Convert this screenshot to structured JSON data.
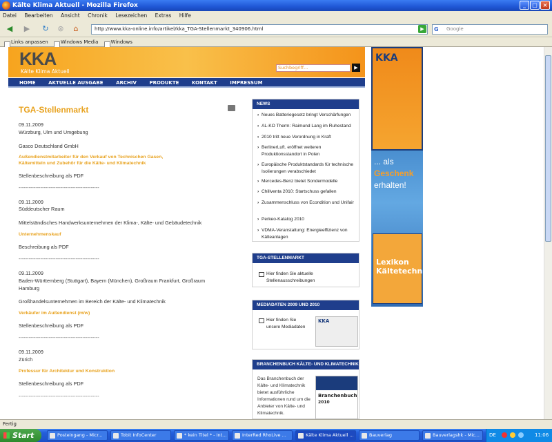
{
  "window": {
    "title": "Kälte Klima Aktuell - Mozilla Firefox",
    "min": "_",
    "max": "□",
    "close": "×"
  },
  "menu": [
    "Datei",
    "Bearbeiten",
    "Ansicht",
    "Chronik",
    "Lesezeichen",
    "Extras",
    "Hilfe"
  ],
  "nav": {
    "url": "http://www.kka-online.info/artikel/kka_TGA-Stellenmarkt_340906.html",
    "search_placeholder": "Google"
  },
  "bookmarks": [
    "Links anpassen",
    "Windows Media",
    "Windows"
  ],
  "site": {
    "logo": "KKA",
    "logo_sub": "Kälte Klima Aktuell",
    "search_placeholder": "Suchbegriff...",
    "nav": [
      "HOME",
      "AKTUELLE AUSGABE",
      "ARCHIV",
      "PRODUKTE",
      "KONTAKT",
      "IMPRESSUM"
    ]
  },
  "main": {
    "title": "TGA-Stellenmarkt",
    "jobs": [
      {
        "date": "09.11.2009",
        "location": "Würzburg, Ulm und Umgebung",
        "company": "Gasco Deutschland GmbH",
        "position": "Außendienstmitarbeiter für den Verkauf von Technischen Gasen, Kältemitteln und Zubehör für die Kälte- und Klimatechnik",
        "pdf": "Stellenbeschreibung als PDF"
      },
      {
        "date": "09.11.2009",
        "location": "Süddeutscher Raum",
        "company": "Mittelständisches Handwerksunternehmen der Klima-, Kälte- und Gebäudetechnik",
        "position": "Unternehmenskauf",
        "pdf": "Beschreibung als PDF"
      },
      {
        "date": "09.11.2009",
        "location": "Baden-Württemberg (Stuttgart), Bayern (München), Großraum Frankfurt, Großraum Hamburg",
        "company": "Großhandelsunternehmen im Bereich der Kälte- und Klimatechnik",
        "position": "Verkäufer im Außendienst (m/w)",
        "pdf": "Stellenbeschreibung als PDF"
      },
      {
        "date": "09.11.2009",
        "location": "Zürich",
        "position": "Professur für Architektur und Konstruktion",
        "pdf": "Stellenbeschreibung als PDF"
      }
    ],
    "separator": "------------------------------------------------"
  },
  "sidebar": {
    "news_head": "NEWS",
    "news": [
      "Neues Batteriegesetz bringt Verschärfungen",
      "AL-KO Therm: Raimund Lang im Ruhestand",
      "2010 tritt neue Verordnung in Kraft",
      "BerlinerLuft. eröffnet weiteren Produktionsstandort in Polen",
      "Europäische Produktstandards für technische Isolierungen verabschiedet",
      "Mercedes-Benz bietet Sondermodelle",
      "Chillventa 2010: Startschuss gefallen",
      "Zusammenschluss von Econdition und Unifair",
      "Perkeo-Katalog 2010",
      "VDMA-Veranstaltung: Energieeffizienz von Kälteanlagen"
    ],
    "tga_head": "TGA-STELLENMARKT",
    "tga_link": "Hier finden Sie aktuelle Stellenausschreibungen",
    "media_head": "MEDIADATEN 2009 UND 2010",
    "media_link": "Hier finden Sie unsere Mediadaten",
    "media_thumb": "KKA",
    "branchen_head": "BRANCHENBUCH KÄLTE- UND KLIMATECHNIK",
    "branchen_text": "Das Branchenbuch der Kälte- und Klimatechnik bietet ausführliche Informationen rund um die Anbieter von Kälte- und Klimatechnik.",
    "branchen_thumb_title": "Branchenbuch",
    "branchen_thumb_year": "2010"
  },
  "ad": {
    "logo": "KKA",
    "line1": "... als",
    "line2": "Geschenk",
    "line3": "erhalten!",
    "book": "Lexikon Kältetechnik"
  },
  "status": "Fertig",
  "taskbar": {
    "start": "Start",
    "items": [
      "Posteingang - Micr...",
      "Tobit InfoCenter",
      "* kein Titel * - Int...",
      "InterRed RhoLive ...",
      "Kälte Klima Aktuell ...",
      "Bauverlag",
      "Bauverlagshk - Mic..."
    ],
    "lang": "DE",
    "clock": "11:06"
  }
}
